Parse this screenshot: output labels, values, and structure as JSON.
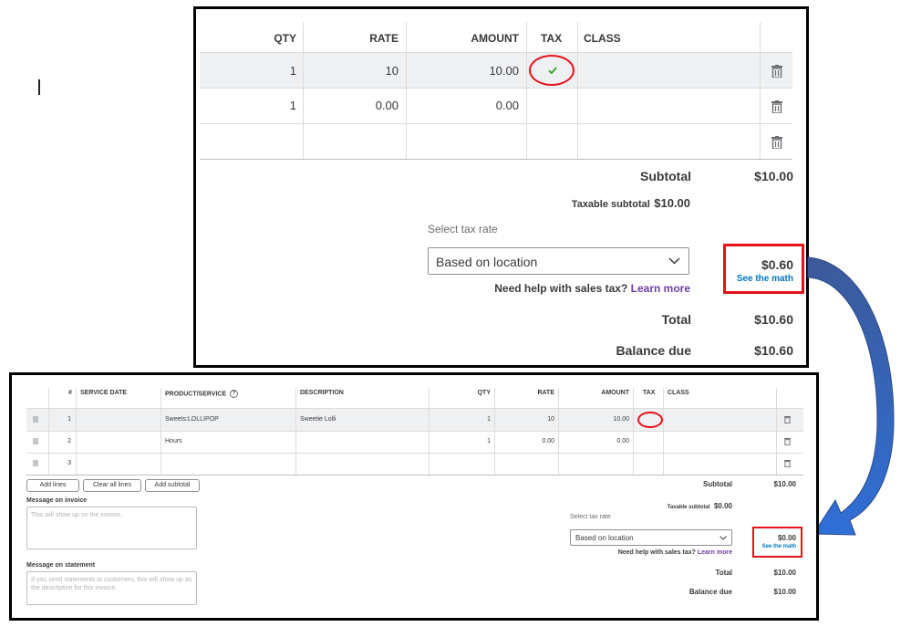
{
  "top_panel": {
    "columns": {
      "qty": "QTY",
      "rate": "RATE",
      "amount": "AMOUNT",
      "tax": "TAX",
      "class": "CLASS"
    },
    "rows": [
      {
        "qty": "1",
        "rate": "10",
        "amount": "10.00",
        "tax_checked": true
      },
      {
        "qty": "1",
        "rate": "0.00",
        "amount": "0.00",
        "tax_checked": false
      },
      {
        "qty": "",
        "rate": "",
        "amount": "",
        "tax_checked": false
      }
    ],
    "subtotal_label": "Subtotal",
    "subtotal_value": "$10.00",
    "taxable_subtotal_label": "Taxable subtotal",
    "taxable_subtotal_value": "$10.00",
    "select_tax_rate_label": "Select tax rate",
    "tax_rate_selected": "Based on location",
    "tax_amount": "$0.60",
    "see_the_math": "See the math",
    "help_text": "Need help with sales tax?",
    "learn_more": "Learn more",
    "total_label": "Total",
    "total_value": "$10.60",
    "balance_due_label": "Balance due",
    "balance_due_value": "$10.60"
  },
  "bottom_panel": {
    "columns": {
      "num": "#",
      "service_date": "SERVICE DATE",
      "product_service": "PRODUCT/SERVICE",
      "description": "DESCRIPTION",
      "qty": "QTY",
      "rate": "RATE",
      "amount": "AMOUNT",
      "tax": "TAX",
      "class": "CLASS"
    },
    "rows": [
      {
        "num": "1",
        "product": "Sweets:LOLLIPOP",
        "description": "Sweetie Lolli",
        "qty": "1",
        "rate": "10",
        "amount": "10.00"
      },
      {
        "num": "2",
        "product": "Hours",
        "description": "",
        "qty": "1",
        "rate": "0.00",
        "amount": "0.00"
      },
      {
        "num": "3",
        "product": "",
        "description": "",
        "qty": "",
        "rate": "",
        "amount": ""
      }
    ],
    "add_lines": "Add lines",
    "clear_all_lines": "Clear all lines",
    "add_subtotal": "Add subtotal",
    "message_on_invoice_label": "Message on invoice",
    "message_on_invoice_placeholder": "This will show up on the invoice.",
    "message_on_statement_label": "Message on statement",
    "message_on_statement_placeholder": "If you send statements to customers, this will show up as the description for this invoice.",
    "subtotal_label": "Subtotal",
    "subtotal_value": "$10.00",
    "taxable_subtotal_label": "Taxable subtotal",
    "taxable_subtotal_value": "$0.00",
    "select_tax_rate_label": "Select tax rate",
    "tax_rate_selected": "Based on location",
    "tax_amount": "$0.00",
    "see_the_math": "See the math",
    "help_text": "Need help with sales tax?",
    "learn_more": "Learn more",
    "total_label": "Total",
    "total_value": "$10.00",
    "balance_due_label": "Balance due",
    "balance_due_value": "$10.00"
  },
  "colors": {
    "highlight": "#e8111a",
    "arrow": "#3a5fbf",
    "link": "#0077c5",
    "check": "#2ca01c"
  }
}
